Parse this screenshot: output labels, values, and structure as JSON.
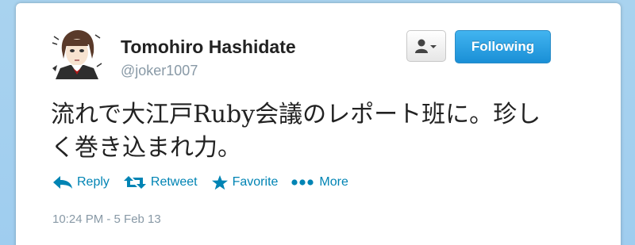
{
  "profile": {
    "name": "Tomohiro Hashidate",
    "handle": "@joker1007"
  },
  "buttons": {
    "follow_label": "Following",
    "user_menu_icon": "user-dropdown-icon"
  },
  "tweet": {
    "text": "流れで大江戸Ruby会議のレポート班に。珍しく巻き込まれ力。",
    "timestamp": "10:24 PM - 5 Feb 13"
  },
  "actions": {
    "reply": "Reply",
    "retweet": "Retweet",
    "favorite": "Favorite",
    "more": "More"
  },
  "colors": {
    "link": "#0084b4",
    "follow_button": "#2ea1e6",
    "muted": "#8899a6",
    "background": "#a9d3ef"
  }
}
